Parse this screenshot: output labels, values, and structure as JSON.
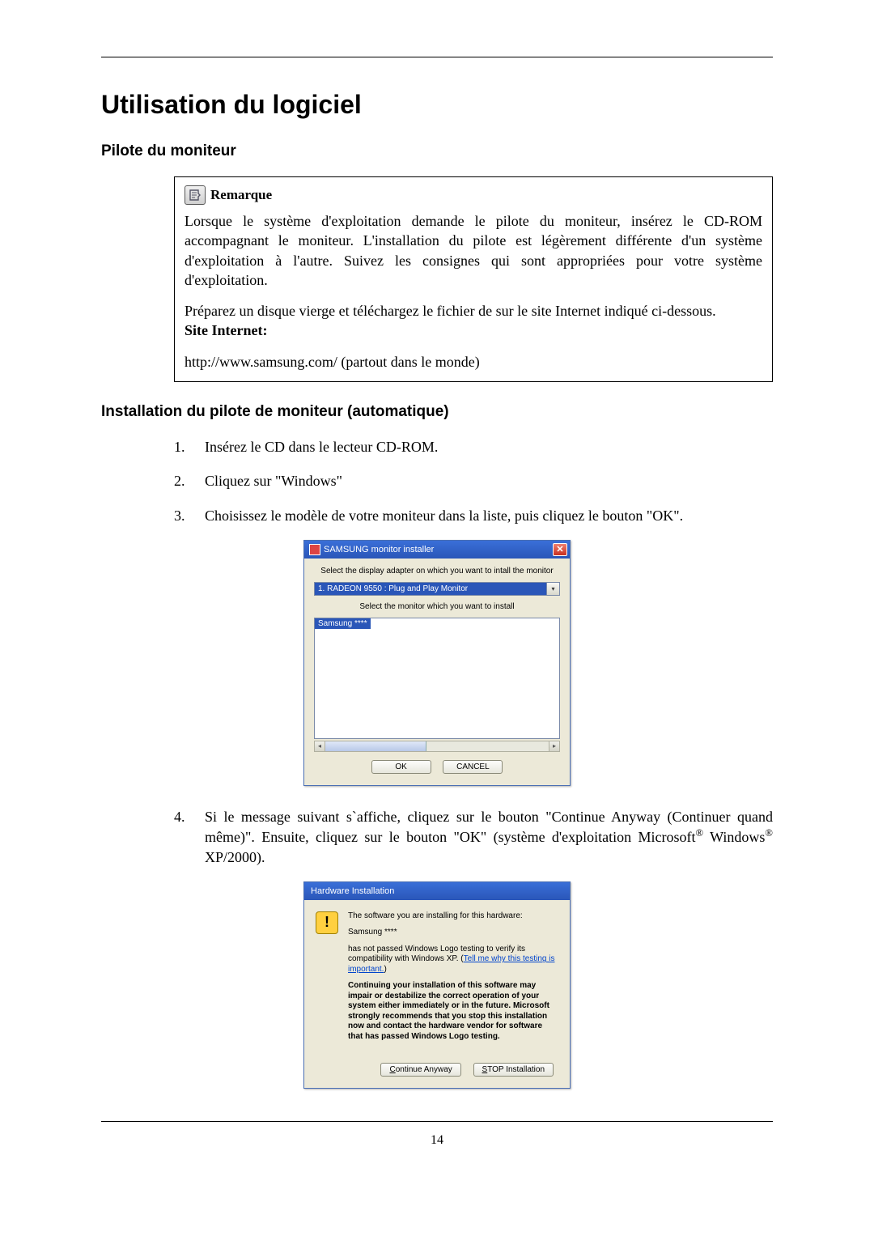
{
  "h1": "Utilisation du logiciel",
  "h2a": "Pilote du moniteur",
  "note": {
    "label": "Remarque",
    "p1": "Lorsque le système d'exploitation demande le pilote du moniteur, insérez le CD-ROM accompagnant le moniteur. L'installation du pilote est légèrement différente d'un système d'exploitation à l'autre. Suivez les consignes qui sont appropriées pour votre système d'exploitation.",
    "p2": "Préparez un disque vierge et téléchargez le fichier de sur le site Internet indiqué ci-dessous.",
    "site_label": "Site Internet:",
    "url": "http://www.samsung.com/ (partout dans le monde)"
  },
  "h2b": "Installation du pilote de moniteur (automatique)",
  "steps": {
    "s1": "Insérez le CD dans le lecteur CD-ROM.",
    "s2": "Cliquez sur \"Windows\"",
    "s3": "Choisissez le modèle de votre moniteur dans la liste, puis cliquez le bouton \"OK\".",
    "s4a": "Si le message suivant s`affiche, cliquez sur le bouton \"Continue Anyway (Continuer quand même)\". Ensuite, cliquez sur le bouton \"OK\" (système d'exploitation Microsoft",
    "s4b": " Windows",
    "s4c": " XP/2000)."
  },
  "dlg1": {
    "title": "SAMSUNG monitor installer",
    "line1": "Select the display adapter on which you want to intall the monitor",
    "combo": "1. RADEON 9550 : Plug and Play Monitor",
    "line2": "Select the monitor which you want to install",
    "list_item": "Samsung ****",
    "ok": "OK",
    "cancel": "CANCEL"
  },
  "dlg2": {
    "title": "Hardware Installation",
    "p1": "The software you are installing for this hardware:",
    "p2": "Samsung ****",
    "p3a": "has not passed Windows Logo testing to verify its compatibility with Windows XP. (",
    "p3_link": "Tell me why this testing is important.",
    "p3b": ")",
    "p4": "Continuing your installation of this software may impair or destabilize the correct operation of your system either immediately or in the future. Microsoft strongly recommends that you stop this installation now and contact the hardware vendor for software that has passed Windows Logo testing.",
    "btn_continue": "Continue Anyway",
    "btn_stop": "STOP Installation"
  },
  "page_num": "14"
}
